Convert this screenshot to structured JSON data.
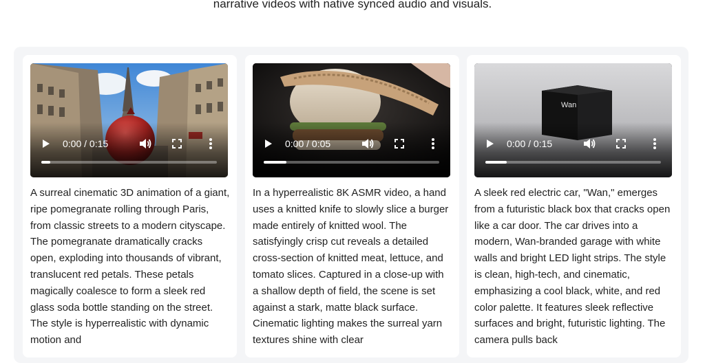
{
  "header": {
    "subtitle": "narrative videos with native synced audio and visuals."
  },
  "cards": [
    {
      "video": {
        "time": "0:00 / 0:15",
        "progress": 0.05,
        "overlay_text": ""
      },
      "description": "A surreal cinematic 3D animation of a giant, ripe pomegranate rolling through Paris, from classic streets to a modern cityscape. The pomegranate dramatically cracks open, exploding into thousands of vibrant, translucent red petals. These petals magically coalesce to form a sleek red glass soda bottle standing on the street. The style is hyperrealistic with dynamic motion and"
    },
    {
      "video": {
        "time": "0:00 / 0:05",
        "progress": 0.13,
        "overlay_text": ""
      },
      "description": "In a hyperrealistic 8K ASMR video, a hand uses a knitted knife to slowly slice a burger made entirely of knitted wool. The satisfyingly crisp cut reveals a detailed cross-section of knitted meat, lettuce, and tomato slices. Captured in a close-up with a shallow depth of field, the scene is set against a stark, matte black surface. Cinematic lighting makes the surreal yarn textures shine with clear"
    },
    {
      "video": {
        "time": "0:00 / 0:15",
        "progress": 0.12,
        "overlay_text": "Wan"
      },
      "description": "A sleek red electric car, \"Wan,\" emerges from a futuristic black box that cracks open like a car door. The car drives into a modern, Wan-branded garage with white walls and bright LED light strips. The style is clean, high-tech, and cinematic, emphasizing a cool black, white, and red color palette. It features sleek reflective surfaces and bright, futuristic lighting. The camera pulls back"
    }
  ]
}
